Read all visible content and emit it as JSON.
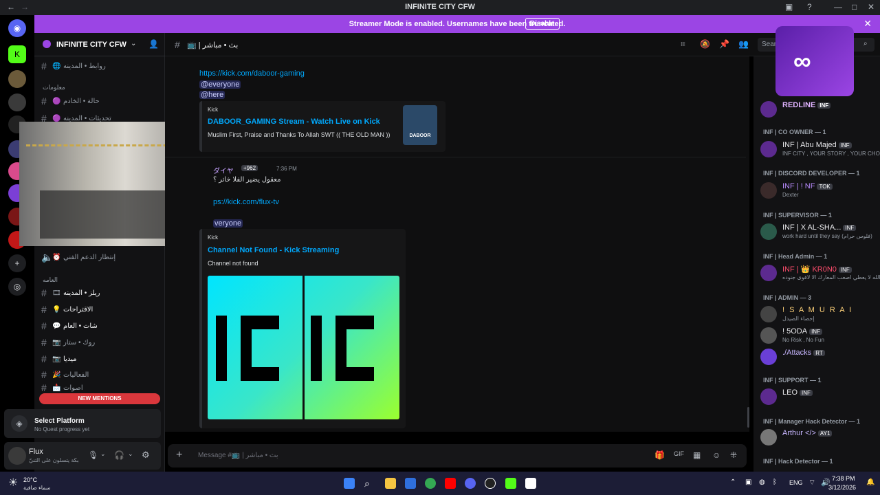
{
  "window": {
    "title": "INFINITE CITY CFW"
  },
  "banner": {
    "text": "Streamer Mode is enabled. Usernames have been truncated.",
    "button": "Disable"
  },
  "server": {
    "name": "INFINITE CITY CFW"
  },
  "channel": {
    "name": "بث • مباشر"
  },
  "search": {
    "placeholder": "Sear"
  },
  "sidebar": {
    "channels_top": [
      {
        "label": "روابط • المدينه"
      }
    ],
    "cat_info": "معلومات",
    "channels_info": [
      {
        "label": "حالة • الخادم"
      },
      {
        "label": "تحديثات • المدينه"
      }
    ],
    "channel_support": "إنتظار الدعم الفني",
    "cat_general": "العامه",
    "channels_general": [
      {
        "label": "ريلز • المدينه"
      },
      {
        "label": "الاقتراحات"
      },
      {
        "label": "شات • العام"
      },
      {
        "label": "روك • ستار"
      },
      {
        "label": "ميديا"
      },
      {
        "label": "الفعاليات"
      },
      {
        "label": "اصوات"
      }
    ],
    "new_mentions": "NEW MENTIONS"
  },
  "quest": {
    "title": "Select Platform",
    "subtitle": "No Quest progress yet"
  },
  "user": {
    "name": "Flux",
    "status": "نحبكة يتسلون على الثنيّ"
  },
  "messages": {
    "msg1": {
      "link": "https://kick.com/daboor-gaming",
      "mention1": "@everyone",
      "mention2": "@here",
      "embed_provider": "Kick",
      "embed_title": "DABOOR_GAMING Stream - Watch Live on Kick",
      "embed_desc": "Muslim First, Praise and Thanks To Allah SWT (( THE OLD MAN ))",
      "thumb_label": "DABOOR"
    },
    "msg2": {
      "author": "ダイヤ",
      "badge": "+962",
      "time": "7:36 PM",
      "text": "معقول يضير الفلا خاتر ؟",
      "link": "https://kick.com/flux-tv",
      "link_visible": "ps://kick.com/flux-tv",
      "mention": "@everyone",
      "mention_visible": "veryone",
      "embed_provider": "Kick",
      "embed_title": "Channel Not Found - Kick Streaming",
      "embed_desc": "Channel not found"
    }
  },
  "composer": {
    "placeholder": "Message #📺 | بث • مباشر"
  },
  "members": {
    "groups": [
      {
        "title": "INF | CO OWNER — 1"
      },
      {
        "title": "INF | DISCORD DEVELOPER — 1"
      },
      {
        "title": "INF | SUPERVISOR — 1"
      },
      {
        "title": "INF | Head Admin — 1"
      },
      {
        "title": "INF | ADMIN — 3"
      },
      {
        "title": "INF | SUPPORT — 1"
      },
      {
        "title": "INF | Manager Hack Detector — 1"
      },
      {
        "title": "INF | Hack Detector — 1"
      }
    ],
    "rows": [
      {
        "name": "REDLINE",
        "tag": "INF",
        "sub": ""
      },
      {
        "name": "INF | Abu Majed",
        "tag": "INF",
        "sub": "INF CITY , YOUR STORY , YOUR CHOICE"
      },
      {
        "name": "INF | ! NF",
        "tag": "TOK",
        "sub": "Dexter"
      },
      {
        "name": "INF | X AL-SHA...",
        "tag": "INF",
        "sub": "work hard until they say (فلوس حرام)"
      },
      {
        "name": "INF | 👑 KR0N0",
        "tag": "INF",
        "sub": "ان الله لا يعطي اصعب المعارك الا لاقوى جنوده"
      },
      {
        "name": "! S A M U R A I",
        "tag": "",
        "sub": "إحصاء الصيدل"
      },
      {
        "name": "! 5ODA",
        "tag": "INF",
        "sub": "No Risk , No Fun"
      },
      {
        "name": "./Attacks",
        "tag": "RT",
        "sub": ""
      },
      {
        "name": "LEO",
        "tag": "INF",
        "sub": ""
      },
      {
        "name": "Arthur </>",
        "tag": "AY1",
        "sub": ""
      }
    ]
  },
  "taskbar": {
    "weather_temp": "20°C",
    "weather_desc": "سماء صافية",
    "lang": "ENG",
    "time": "7:38 PM",
    "date": "3/12/2026"
  },
  "colors": {
    "accent": "#9b45e4",
    "link": "#00a8fc",
    "danger": "#da373c"
  }
}
